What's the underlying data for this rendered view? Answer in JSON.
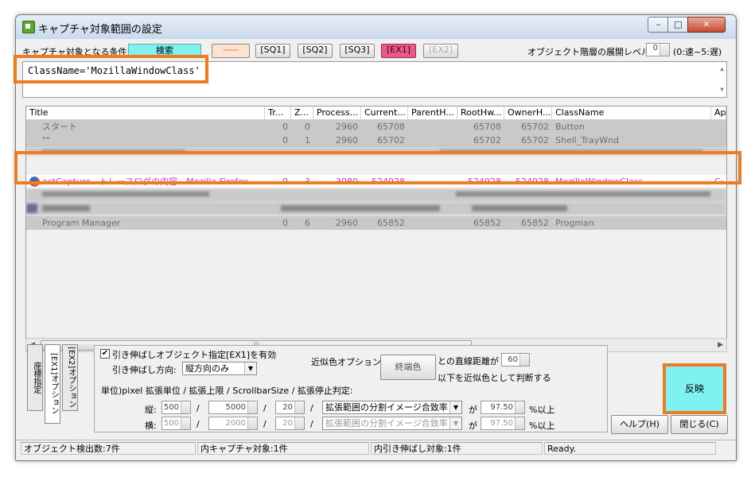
{
  "window": {
    "title": "キャプチャ対象範囲の設定"
  },
  "toolbar": {
    "condition_label": "キャプチャ対象となる条件:",
    "search_label": "検索",
    "dash_label": "-----",
    "sq1": "[SQ1]",
    "sq2": "[SQ2]",
    "sq3": "[SQ3]",
    "ex1": "[EX1]",
    "ex2": "[EX2]",
    "expand_level_label": "オブジェクト階層の展開レベル:",
    "expand_level_value": "0",
    "expand_level_hint": "(0:速~5:遅)"
  },
  "query": {
    "value": "ClassName='MozillaWindowClass'"
  },
  "table": {
    "headers": [
      "Title",
      "Tr...",
      "Z...",
      "Process...",
      "Current...",
      "ParentH...",
      "RootHw...",
      "OwnerH...",
      "ClassName",
      "Ap"
    ],
    "rows": [
      {
        "title": "スタート",
        "tr": "0",
        "z": "0",
        "process": "2960",
        "current": "65708",
        "parent": "",
        "root": "65708",
        "owner": "65702",
        "class": "Button",
        "ap": "",
        "state": "normal"
      },
      {
        "title": "\"\"",
        "tr": "0",
        "z": "1",
        "process": "2960",
        "current": "65702",
        "parent": "",
        "root": "65702",
        "owner": "65702",
        "class": "Shell_TrayWnd",
        "ap": "",
        "state": "normal"
      },
      {
        "title": "actCapture - トレースログの内容 - Mozilla Firefox",
        "tr": "0",
        "z": "3",
        "process": "3080",
        "current": "524928",
        "parent": "",
        "root": "524928",
        "owner": "524928",
        "class": "MozillaWindowClass",
        "ap": "C:",
        "state": "selected"
      },
      {
        "title": "Program Manager",
        "tr": "0",
        "z": "6",
        "process": "2960",
        "current": "65852",
        "parent": "",
        "root": "65852",
        "owner": "65852",
        "class": "Progman",
        "ap": "",
        "state": "normal"
      }
    ]
  },
  "tabs": {
    "coord": "座標指定",
    "ex1": "[EX1]オプション",
    "ex2": "[EX2]オプション"
  },
  "options": {
    "stretch_enable_label": "引き伸ばしオブジェクト指定[EX1]を有効",
    "stretch_enable_checked": "✔",
    "direction_label": "引き伸ばし方向:",
    "direction_value": "縦方向のみ",
    "similar_color_label": "近似色オプション:",
    "end_color_button": "終端色",
    "distance_label": "との直線距離が",
    "distance_value": "60",
    "distance_suffix": "以下を近似色として判断する",
    "unit_line": "単位)pixel  拡張単位 / 拡張上限 / ScrollbarSize / 拡張停止判定:",
    "vertical_label": "縦:",
    "horizontal_label": "横:",
    "slash": "/",
    "v_unit": "500",
    "v_limit": "5000",
    "v_scroll": "20",
    "h_unit": "500",
    "h_limit": "2000",
    "h_scroll": "20",
    "v_stop": "拡張範囲の分割イメージ合致率",
    "h_stop": "拡張範囲の分割イメージ合致率",
    "ga": "が",
    "v_rate": "97.50",
    "h_rate": "97.50",
    "pct": "%以上"
  },
  "buttons": {
    "apply": "反映",
    "help": "ヘルプ(H)",
    "close": "閉じる(C)"
  },
  "status": {
    "detected": "オブジェクト検出数:7件",
    "capture": "内キャプチャ対象:1件",
    "stretch": "内引き伸ばし対象:1件",
    "ready": "Ready."
  },
  "colors": {
    "highlight": "#f07c22",
    "cyan": "#7ff1f1",
    "selected_text": "#c23bbf"
  }
}
